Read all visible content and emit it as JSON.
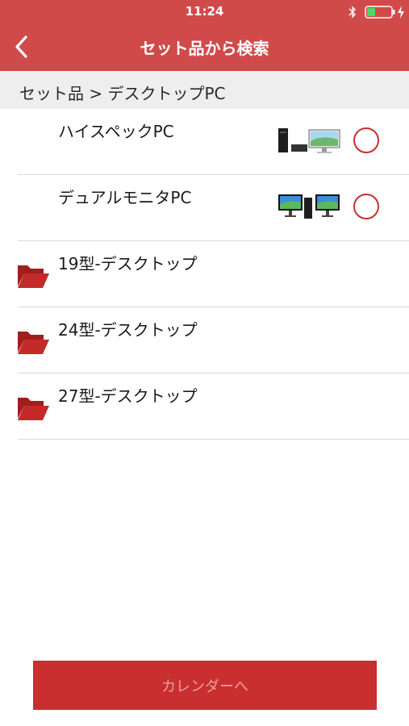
{
  "status_bar": {
    "time": "11:24",
    "battery_level": 0.35
  },
  "header": {
    "title": "セット品から検索",
    "back_icon": "chevron-left-icon"
  },
  "breadcrumb": {
    "text": "セット品 > デスクトップPC"
  },
  "items": [
    {
      "label": "ハイスペックPC",
      "type": "product",
      "thumbnail_icon": "desktop-pc-set-icon"
    },
    {
      "label": "デュアルモニタPC",
      "type": "product",
      "thumbnail_icon": "dual-monitor-pc-icon"
    },
    {
      "label": "19型-デスクトップ",
      "type": "folder",
      "icon": "folder-open-icon"
    },
    {
      "label": "24型-デスクトップ",
      "type": "folder",
      "icon": "folder-open-icon"
    },
    {
      "label": "27型-デスクトップ",
      "type": "folder",
      "icon": "folder-open-icon"
    }
  ],
  "footer": {
    "button_label": "カレンダーへ"
  },
  "colors": {
    "header": "#d14a4a",
    "accent": "#c92f2f",
    "breadcrumb_bg": "#eeeeee",
    "button_text": "#e8a0a0"
  }
}
